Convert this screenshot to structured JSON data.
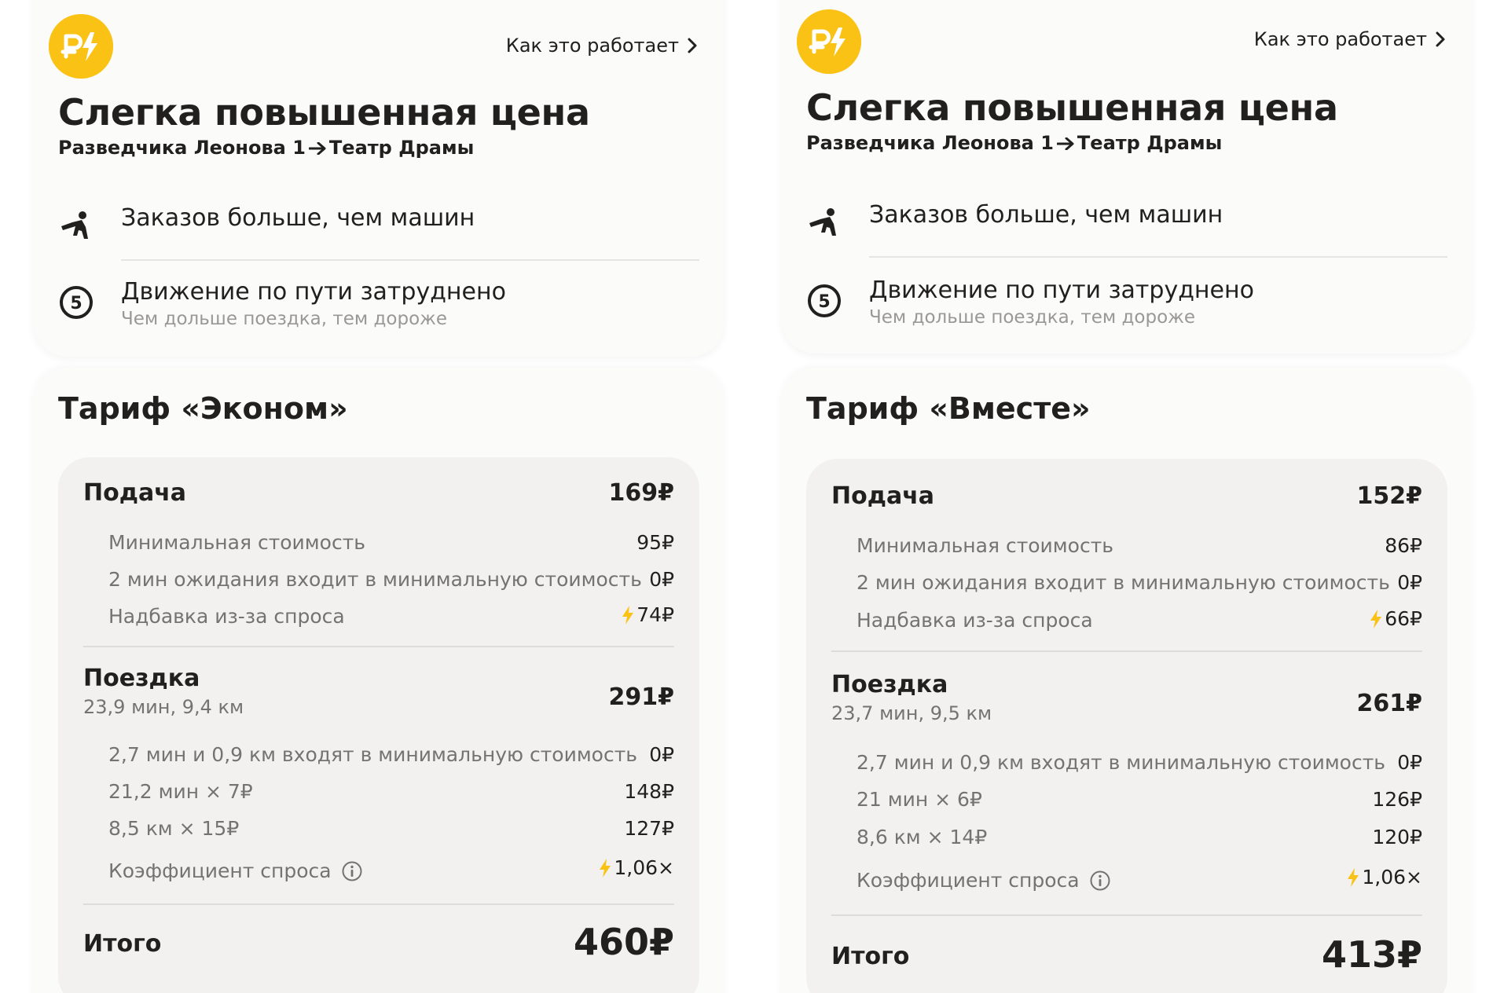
{
  "colors": {
    "accent": "#fbc216",
    "text": "#21201f",
    "muted": "#75736f",
    "subtle": "#9a9896"
  },
  "panels": [
    {
      "how_link": "Как это работает",
      "title": "Слегка повышенная цена",
      "route": {
        "from": "Разведчика Леонова 1",
        "to": "Театр Драмы"
      },
      "reasons": [
        {
          "icon": "demand-person-icon",
          "title": "Заказов больше, чем машин",
          "subtitle": ""
        },
        {
          "icon": "traffic-level-5-icon",
          "title": "Движение по пути затруднено",
          "subtitle": "Чем дольше поездка, тем дороже",
          "badge": "5"
        }
      ],
      "tariff_title": "Тариф «Эконом»",
      "pickup": {
        "title": "Подача",
        "amount": "169₽",
        "rows": [
          {
            "label": "Минимальная стоимость",
            "value": "95₽"
          },
          {
            "label": "2 мин ожидания входит в минимальную стоимость",
            "value": "0₽"
          },
          {
            "label": "Надбавка из-за спроса",
            "value": "74₽",
            "bolt": true
          }
        ]
      },
      "ride": {
        "title": "Поездка",
        "subtitle": "23,9 мин, 9,4 км",
        "amount": "291₽",
        "rows": [
          {
            "label": "2,7 мин и 0,9 км входят в минимальную стоимость",
            "value": "0₽"
          },
          {
            "label": "21,2 мин × 7₽",
            "value": "148₽"
          },
          {
            "label": "8,5 км × 15₽",
            "value": "127₽"
          },
          {
            "label": "Коэффициент спроса",
            "value": "1,06×",
            "bolt": true,
            "info": true
          }
        ]
      },
      "total": {
        "label": "Итого",
        "amount": "460₽"
      }
    },
    {
      "how_link": "Как это работает",
      "title": "Слегка повышенная цена",
      "route": {
        "from": "Разведчика Леонова 1",
        "to": "Театр Драмы"
      },
      "reasons": [
        {
          "icon": "demand-person-icon",
          "title": "Заказов больше, чем машин",
          "subtitle": ""
        },
        {
          "icon": "traffic-level-5-icon",
          "title": "Движение по пути затруднено",
          "subtitle": "Чем дольше поездка, тем дороже",
          "badge": "5"
        }
      ],
      "tariff_title": "Тариф «Вместе»",
      "pickup": {
        "title": "Подача",
        "amount": "152₽",
        "rows": [
          {
            "label": "Минимальная стоимость",
            "value": "86₽"
          },
          {
            "label": "2 мин ожидания входит в минимальную стоимость",
            "value": "0₽"
          },
          {
            "label": "Надбавка из-за спроса",
            "value": "66₽",
            "bolt": true
          }
        ]
      },
      "ride": {
        "title": "Поездка",
        "subtitle": "23,7 мин, 9,5 км",
        "amount": "261₽",
        "rows": [
          {
            "label": "2,7 мин и 0,9 км входят в минимальную стоимость",
            "value": "0₽"
          },
          {
            "label": "21 мин × 6₽",
            "value": "126₽"
          },
          {
            "label": "8,6 км × 14₽",
            "value": "120₽"
          },
          {
            "label": "Коэффициент спроса",
            "value": "1,06×",
            "bolt": true,
            "info": true
          }
        ]
      },
      "total": {
        "label": "Итого",
        "amount": "413₽"
      }
    }
  ]
}
